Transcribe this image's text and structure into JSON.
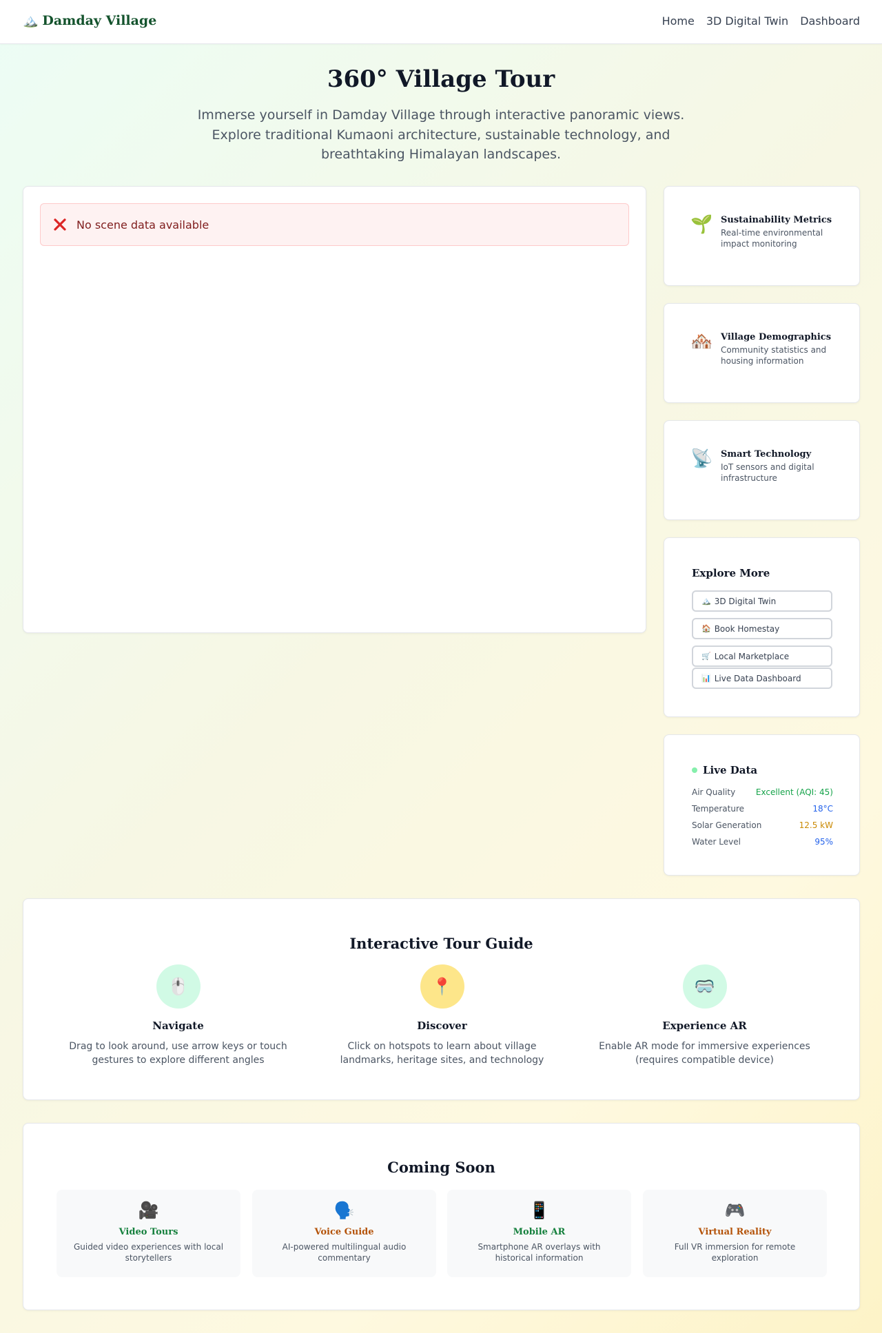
{
  "header": {
    "brand_icon": "mountain-icon",
    "brand_glyph": "🏔️",
    "brand": "Damday Village",
    "nav": [
      "Home",
      "3D Digital Twin",
      "Dashboard"
    ]
  },
  "hero": {
    "title": "360° Village Tour",
    "subtitle": "Immerse yourself in Damday Village through interactive panoramic views. Explore traditional Kumaoni architecture, sustainable technology, and breathtaking Himalayan landscapes."
  },
  "viewer": {
    "error_icon": "close-x-icon",
    "error_text": "No scene data available"
  },
  "side_cards": [
    {
      "icon": "seedling-icon",
      "glyph": "🌱",
      "title": "Sustainability Metrics",
      "desc": "Real-time environmental impact monitoring"
    },
    {
      "icon": "houses-icon",
      "glyph": "🏘️",
      "title": "Village Demographics",
      "desc": "Community statistics and housing information"
    },
    {
      "icon": "satellite-icon",
      "glyph": "📡",
      "title": "Smart Technology",
      "desc": "IoT sensors and digital infrastructure"
    }
  ],
  "explore": {
    "title": "Explore More",
    "buttons": [
      {
        "icon": "mountain-icon",
        "glyph": "🏔️",
        "label": "3D Digital Twin"
      },
      {
        "icon": "house-icon",
        "glyph": "🏠",
        "label": "Book Homestay"
      },
      {
        "icon": "cart-icon",
        "glyph": "🛒",
        "label": "Local Marketplace"
      },
      {
        "icon": "chart-icon",
        "glyph": "📊",
        "label": "Live Data Dashboard"
      }
    ]
  },
  "live": {
    "title": "Live Data",
    "rows": [
      {
        "label": "Air Quality",
        "value": "Excellent (AQI: 45)",
        "color": "#16a34a"
      },
      {
        "label": "Temperature",
        "value": "18°C",
        "color": "#2563eb"
      },
      {
        "label": "Solar Generation",
        "value": "12.5 kW",
        "color": "#ca8a04"
      },
      {
        "label": "Water Level",
        "value": "95%",
        "color": "#2563eb"
      }
    ]
  },
  "guide": {
    "title": "Interactive Tour Guide",
    "items": [
      {
        "icon": "mouse-icon",
        "glyph": "🖱️",
        "bg": "#d1fae5",
        "title": "Navigate",
        "desc": "Drag to look around, use arrow keys or touch gestures to explore different angles"
      },
      {
        "icon": "pin-icon",
        "glyph": "📍",
        "bg": "#fde68a",
        "title": "Discover",
        "desc": "Click on hotspots to learn about village landmarks, heritage sites, and technology"
      },
      {
        "icon": "goggles-icon",
        "glyph": "🥽",
        "bg": "#d1fae5",
        "title": "Experience AR",
        "desc": "Enable AR mode for immersive experiences (requires compatible device)"
      }
    ]
  },
  "soon": {
    "title": "Coming Soon",
    "items": [
      {
        "icon": "video-camera-icon",
        "glyph": "🎥",
        "title": "Video Tours",
        "color": "#15803d",
        "desc": "Guided video experiences with local storytellers"
      },
      {
        "icon": "speaking-head-icon",
        "glyph": "🗣️",
        "title": "Voice Guide",
        "color": "#b45309",
        "desc": "AI-powered multilingual audio commentary"
      },
      {
        "icon": "phone-icon",
        "glyph": "📱",
        "title": "Mobile AR",
        "color": "#15803d",
        "desc": "Smartphone AR overlays with historical information"
      },
      {
        "icon": "gamepad-icon",
        "glyph": "🎮",
        "title": "Virtual Reality",
        "color": "#b45309",
        "desc": "Full VR immersion for remote exploration"
      }
    ]
  }
}
